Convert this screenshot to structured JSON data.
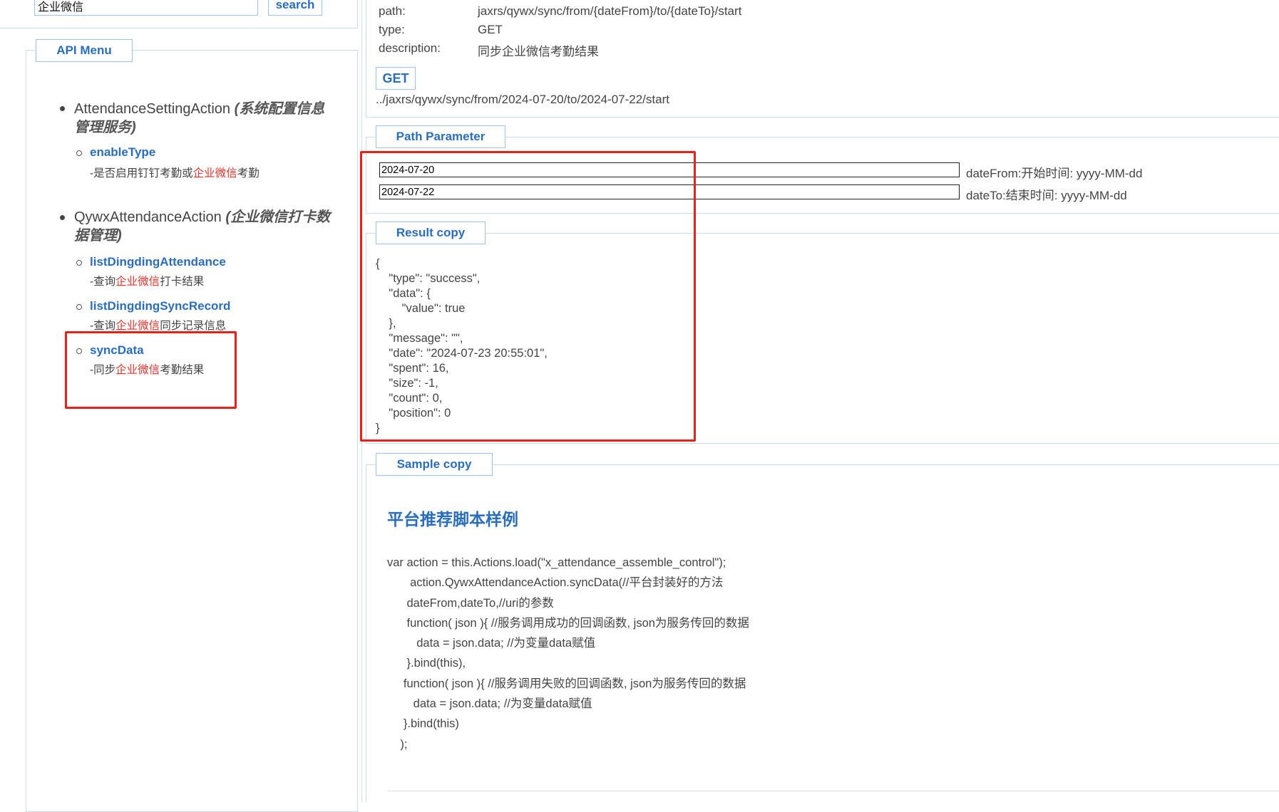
{
  "search": {
    "value": "企业微信",
    "button_label": "search"
  },
  "menu": {
    "title": "API Menu",
    "actions": [
      {
        "name": "AttendanceSettingAction",
        "desc_line1": "(系统配置信息",
        "desc_line2": "管理服务)",
        "items": [
          {
            "label": "enableType",
            "desc_pre": "-是否启用钉钉考勤或",
            "desc_hl": "企业微信",
            "desc_post": "考勤"
          }
        ]
      },
      {
        "name": "QywxAttendanceAction",
        "desc_line1": "(企业微信打卡数",
        "desc_line2": "据管理)",
        "items": [
          {
            "label": "listDingdingAttendance",
            "desc_pre": "-查询",
            "desc_hl": "企业微信",
            "desc_post": "打卡结果"
          },
          {
            "label": "listDingdingSyncRecord",
            "desc_pre": "-查询",
            "desc_hl": "企业微信",
            "desc_post": "同步记录信息"
          },
          {
            "label": "syncData",
            "desc_pre": "-同步",
            "desc_hl": "企业微信",
            "desc_post": "考勤结果"
          }
        ]
      }
    ]
  },
  "api_info": {
    "path_label": "path:",
    "path_value": "jaxrs/qywx/sync/from/{dateFrom}/to/{dateTo}/start",
    "type_label": "type:",
    "type_value": "GET",
    "description_label": "description:",
    "description_value": "同步企业微信考勤结果",
    "method": "GET",
    "request_url": "../jaxrs/qywx/sync/from/2024-07-20/to/2024-07-22/start"
  },
  "path_parameter": {
    "title": "Path Parameter",
    "params": [
      {
        "value": "2024-07-20",
        "note": "dateFrom:开始时间: yyyy-MM-dd"
      },
      {
        "value": "2024-07-22",
        "note": "dateTo:结束时间: yyyy-MM-dd"
      }
    ]
  },
  "result": {
    "title": "Result copy",
    "lines": [
      "{",
      "    \"type\": \"success\",",
      "    \"data\": {",
      "        \"value\": true",
      "    },",
      "    \"message\": \"\",",
      "    \"date\": \"2024-07-23 20:55:01\",",
      "    \"spent\": 16,",
      "    \"size\": -1,",
      "    \"count\": 0,",
      "    \"position\": 0",
      "}"
    ]
  },
  "sample": {
    "title": "Sample copy",
    "heading": "平台推荐脚本样例",
    "code_lines": [
      "var action = this.Actions.load(\"x_attendance_assemble_control\");",
      "       action.QywxAttendanceAction.syncData(//平台封装好的方法",
      "      dateFrom,dateTo,//uri的参数",
      "      function( json ){ //服务调用成功的回调函数, json为服务传回的数据",
      "         data = json.data; //为变量data赋值",
      "      }.bind(this),",
      "     function( json ){ //服务调用失败的回调函数, json为服务传回的数据",
      "        data = json.data; //为变量data赋值",
      "     }.bind(this)",
      "    );"
    ]
  },
  "colors": {
    "accent": "#2a6ebb",
    "highlight": "#e8211d",
    "keyword": "#e8322b",
    "border": "#c9ddef"
  }
}
